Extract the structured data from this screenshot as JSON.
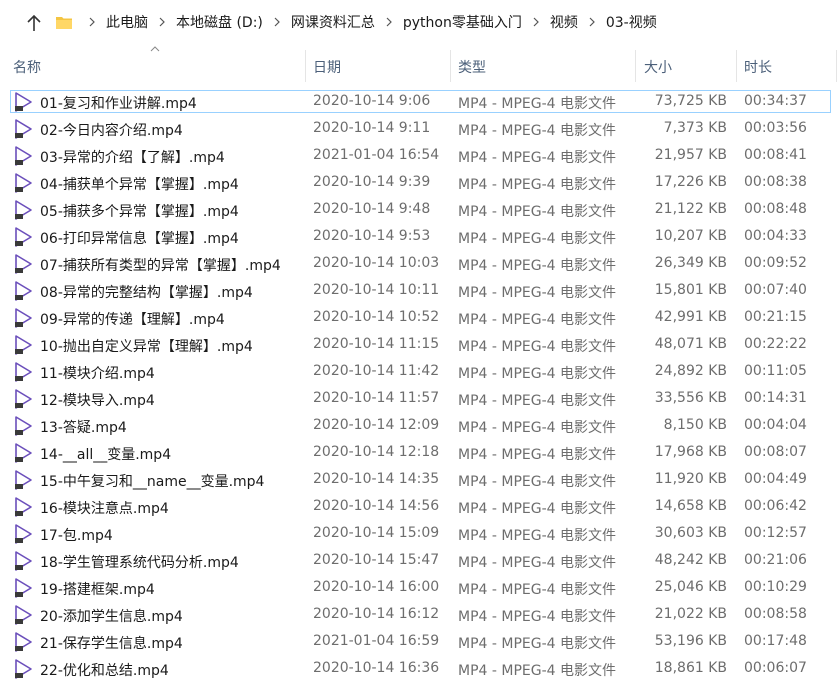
{
  "breadcrumb": [
    "此电脑",
    "本地磁盘 (D:)",
    "网课资料汇总",
    "python零基础入门",
    "视频",
    "03-视频"
  ],
  "columns": {
    "name": "名称",
    "date": "日期",
    "type": "类型",
    "size": "大小",
    "duration": "时长"
  },
  "colors": {
    "play_icon": "#6b4fbb",
    "selection_border": "#99d1ff",
    "folder": "#f4c542"
  },
  "files": [
    {
      "name": "01-复习和作业讲解.mp4",
      "date": "2020-10-14 9:06",
      "type": "MP4 - MPEG-4 电影文件",
      "size": "73,725 KB",
      "duration": "00:34:37"
    },
    {
      "name": "02-今日内容介绍.mp4",
      "date": "2020-10-14 9:11",
      "type": "MP4 - MPEG-4 电影文件",
      "size": "7,373 KB",
      "duration": "00:03:56"
    },
    {
      "name": "03-异常的介绍【了解】.mp4",
      "date": "2021-01-04 16:54",
      "type": "MP4 - MPEG-4 电影文件",
      "size": "21,957 KB",
      "duration": "00:08:41"
    },
    {
      "name": "04-捕获单个异常【掌握】.mp4",
      "date": "2020-10-14 9:39",
      "type": "MP4 - MPEG-4 电影文件",
      "size": "17,226 KB",
      "duration": "00:08:38"
    },
    {
      "name": "05-捕获多个异常【掌握】.mp4",
      "date": "2020-10-14 9:48",
      "type": "MP4 - MPEG-4 电影文件",
      "size": "21,122 KB",
      "duration": "00:08:48"
    },
    {
      "name": "06-打印异常信息【掌握】.mp4",
      "date": "2020-10-14 9:53",
      "type": "MP4 - MPEG-4 电影文件",
      "size": "10,207 KB",
      "duration": "00:04:33"
    },
    {
      "name": "07-捕获所有类型的异常【掌握】.mp4",
      "date": "2020-10-14 10:03",
      "type": "MP4 - MPEG-4 电影文件",
      "size": "26,349 KB",
      "duration": "00:09:52"
    },
    {
      "name": "08-异常的完整结构【掌握】.mp4",
      "date": "2020-10-14 10:11",
      "type": "MP4 - MPEG-4 电影文件",
      "size": "15,801 KB",
      "duration": "00:07:40"
    },
    {
      "name": "09-异常的传递【理解】.mp4",
      "date": "2020-10-14 10:52",
      "type": "MP4 - MPEG-4 电影文件",
      "size": "42,991 KB",
      "duration": "00:21:15"
    },
    {
      "name": "10-抛出自定义异常【理解】.mp4",
      "date": "2020-10-14 11:15",
      "type": "MP4 - MPEG-4 电影文件",
      "size": "48,071 KB",
      "duration": "00:22:22"
    },
    {
      "name": "11-模块介绍.mp4",
      "date": "2020-10-14 11:42",
      "type": "MP4 - MPEG-4 电影文件",
      "size": "24,892 KB",
      "duration": "00:11:05"
    },
    {
      "name": "12-模块导入.mp4",
      "date": "2020-10-14 11:57",
      "type": "MP4 - MPEG-4 电影文件",
      "size": "33,556 KB",
      "duration": "00:14:31"
    },
    {
      "name": "13-答疑.mp4",
      "date": "2020-10-14 12:09",
      "type": "MP4 - MPEG-4 电影文件",
      "size": "8,150 KB",
      "duration": "00:04:04"
    },
    {
      "name": "14-__all__变量.mp4",
      "date": "2020-10-14 12:18",
      "type": "MP4 - MPEG-4 电影文件",
      "size": "17,968 KB",
      "duration": "00:08:07"
    },
    {
      "name": "15-中午复习和__name__变量.mp4",
      "date": "2020-10-14 14:35",
      "type": "MP4 - MPEG-4 电影文件",
      "size": "11,920 KB",
      "duration": "00:04:49"
    },
    {
      "name": "16-模块注意点.mp4",
      "date": "2020-10-14 14:56",
      "type": "MP4 - MPEG-4 电影文件",
      "size": "14,658 KB",
      "duration": "00:06:42"
    },
    {
      "name": "17-包.mp4",
      "date": "2020-10-14 15:09",
      "type": "MP4 - MPEG-4 电影文件",
      "size": "30,603 KB",
      "duration": "00:12:57"
    },
    {
      "name": "18-学生管理系统代码分析.mp4",
      "date": "2020-10-14 15:47",
      "type": "MP4 - MPEG-4 电影文件",
      "size": "48,242 KB",
      "duration": "00:21:06"
    },
    {
      "name": "19-搭建框架.mp4",
      "date": "2020-10-14 16:00",
      "type": "MP4 - MPEG-4 电影文件",
      "size": "25,046 KB",
      "duration": "00:10:29"
    },
    {
      "name": "20-添加学生信息.mp4",
      "date": "2020-10-14 16:12",
      "type": "MP4 - MPEG-4 电影文件",
      "size": "21,022 KB",
      "duration": "00:08:58"
    },
    {
      "name": "21-保存学生信息.mp4",
      "date": "2021-01-04 16:59",
      "type": "MP4 - MPEG-4 电影文件",
      "size": "53,196 KB",
      "duration": "00:17:48"
    },
    {
      "name": "22-优化和总结.mp4",
      "date": "2020-10-14 16:36",
      "type": "MP4 - MPEG-4 电影文件",
      "size": "18,861 KB",
      "duration": "00:06:07"
    }
  ]
}
